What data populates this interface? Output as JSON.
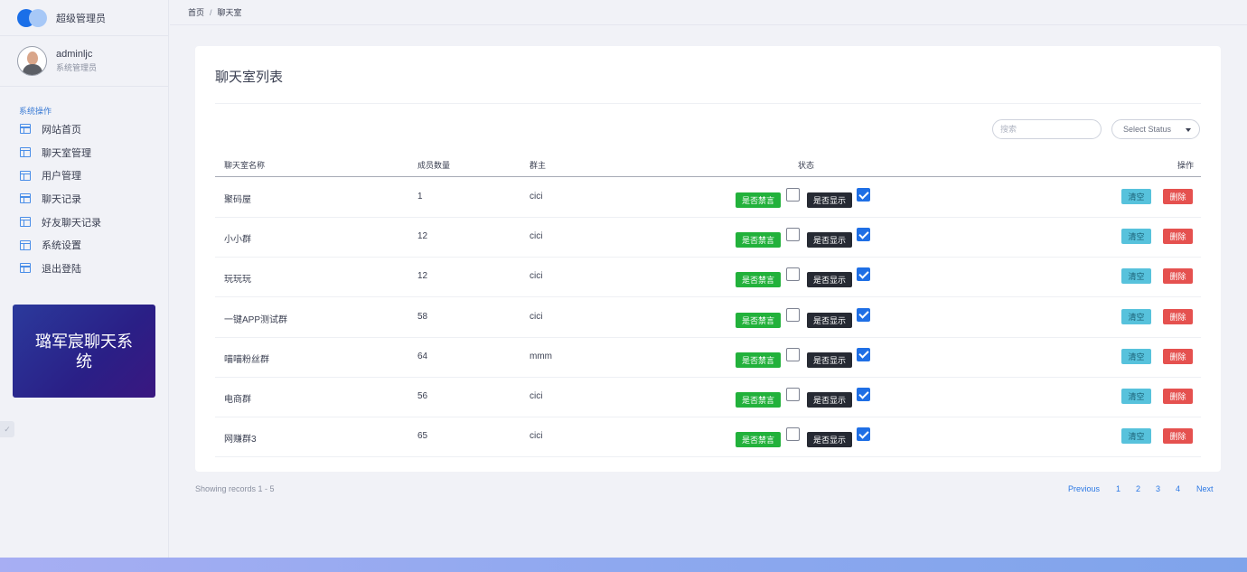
{
  "brand": {
    "title": "超级管理员"
  },
  "profile": {
    "name": "adminljc",
    "role": "系统管理员"
  },
  "sidebar": {
    "section": "系统操作",
    "items": [
      {
        "label": "网站首页"
      },
      {
        "label": "聊天室管理"
      },
      {
        "label": "用户管理"
      },
      {
        "label": "聊天记录"
      },
      {
        "label": "好友聊天记录"
      },
      {
        "label": "系统设置"
      },
      {
        "label": "退出登陆"
      }
    ],
    "promo": "璐军宸聊天系统"
  },
  "breadcrumb": {
    "home": "首页",
    "separator": "/",
    "current": "聊天室"
  },
  "card": {
    "title": "聊天室列表"
  },
  "filters": {
    "search_placeholder": "搜索",
    "status_select": "Select Status"
  },
  "table": {
    "headers": {
      "name": "聊天室名称",
      "members": "成员数量",
      "owner": "群主",
      "status": "状态",
      "actions": "操作"
    },
    "status_labels": {
      "mute": "是否禁言",
      "show": "是否显示"
    },
    "action_labels": {
      "clear": "清空",
      "delete": "删除"
    },
    "rows": [
      {
        "name": "聚码屋",
        "members": "1",
        "owner": "cici",
        "mute": false,
        "show": true
      },
      {
        "name": "小小群",
        "members": "12",
        "owner": "cici",
        "mute": false,
        "show": true
      },
      {
        "name": "玩玩玩",
        "members": "12",
        "owner": "cici",
        "mute": false,
        "show": true
      },
      {
        "name": "一键APP测试群",
        "members": "58",
        "owner": "cici",
        "mute": false,
        "show": true
      },
      {
        "name": "喵喵粉丝群",
        "members": "64",
        "owner": "mmm",
        "mute": false,
        "show": true
      },
      {
        "name": "电商群",
        "members": "56",
        "owner": "cici",
        "mute": false,
        "show": true
      },
      {
        "name": "网赚群3",
        "members": "65",
        "owner": "cici",
        "mute": false,
        "show": true
      }
    ]
  },
  "pagination": {
    "info": "Showing records 1 - 5",
    "previous": "Previous",
    "pages": [
      "1",
      "2",
      "3",
      "4"
    ],
    "next": "Next"
  },
  "colors": {
    "accent": "#1f6fe5",
    "mute_tag": "#22b13b",
    "show_tag": "#262a33",
    "clear_button": "#57c2dc",
    "delete_button": "#e5514f",
    "promo": "#2a1f86"
  }
}
